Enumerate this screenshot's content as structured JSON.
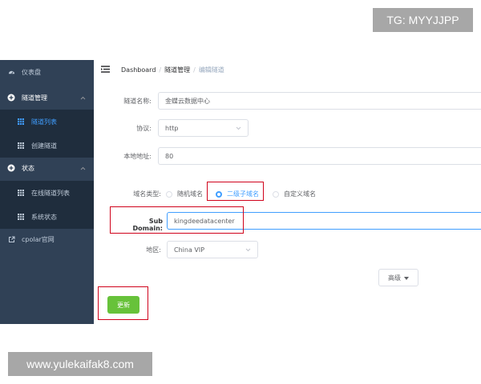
{
  "watermarks": {
    "top": "TG: MYYJJPP",
    "bottom": "www.yulekaifak8.com"
  },
  "sidebar": {
    "items": [
      {
        "label": "仪表盘",
        "icon": "dashboard-icon"
      },
      {
        "label": "隧道管理",
        "icon": "plus-circle-icon"
      },
      {
        "label": "隧道列表",
        "icon": "grid-icon",
        "active": true
      },
      {
        "label": "创建隧道",
        "icon": "grid-icon"
      },
      {
        "label": "状态",
        "icon": "plus-circle-icon"
      },
      {
        "label": "在线隧道列表",
        "icon": "grid-icon"
      },
      {
        "label": "系统状态",
        "icon": "grid-icon"
      },
      {
        "label": "cpolar官网",
        "icon": "external-link-icon"
      }
    ]
  },
  "breadcrumb": {
    "items": [
      "Dashboard",
      "隧道管理",
      "编辑隧道"
    ]
  },
  "form": {
    "tunnel_name": {
      "label": "隧道名称:",
      "value": "金蝶云数据中心"
    },
    "protocol": {
      "label": "协议:",
      "value": "http"
    },
    "local_address": {
      "label": "本地地址:",
      "value": "80"
    },
    "domain_type": {
      "label": "域名类型:",
      "options": [
        "随机域名",
        "二级子域名",
        "自定义域名"
      ],
      "selected": "二级子域名"
    },
    "sub_domain": {
      "label": "Sub Domain:",
      "value": "kingdeedatacenter"
    },
    "region": {
      "label": "地区:",
      "value": "China VIP"
    },
    "advanced_label": "高级",
    "update_label": "更新"
  },
  "colors": {
    "sidebar_bg": "#304156",
    "active": "#409eff",
    "update_button": "#67c23a",
    "highlight_box": "#d0021b"
  }
}
